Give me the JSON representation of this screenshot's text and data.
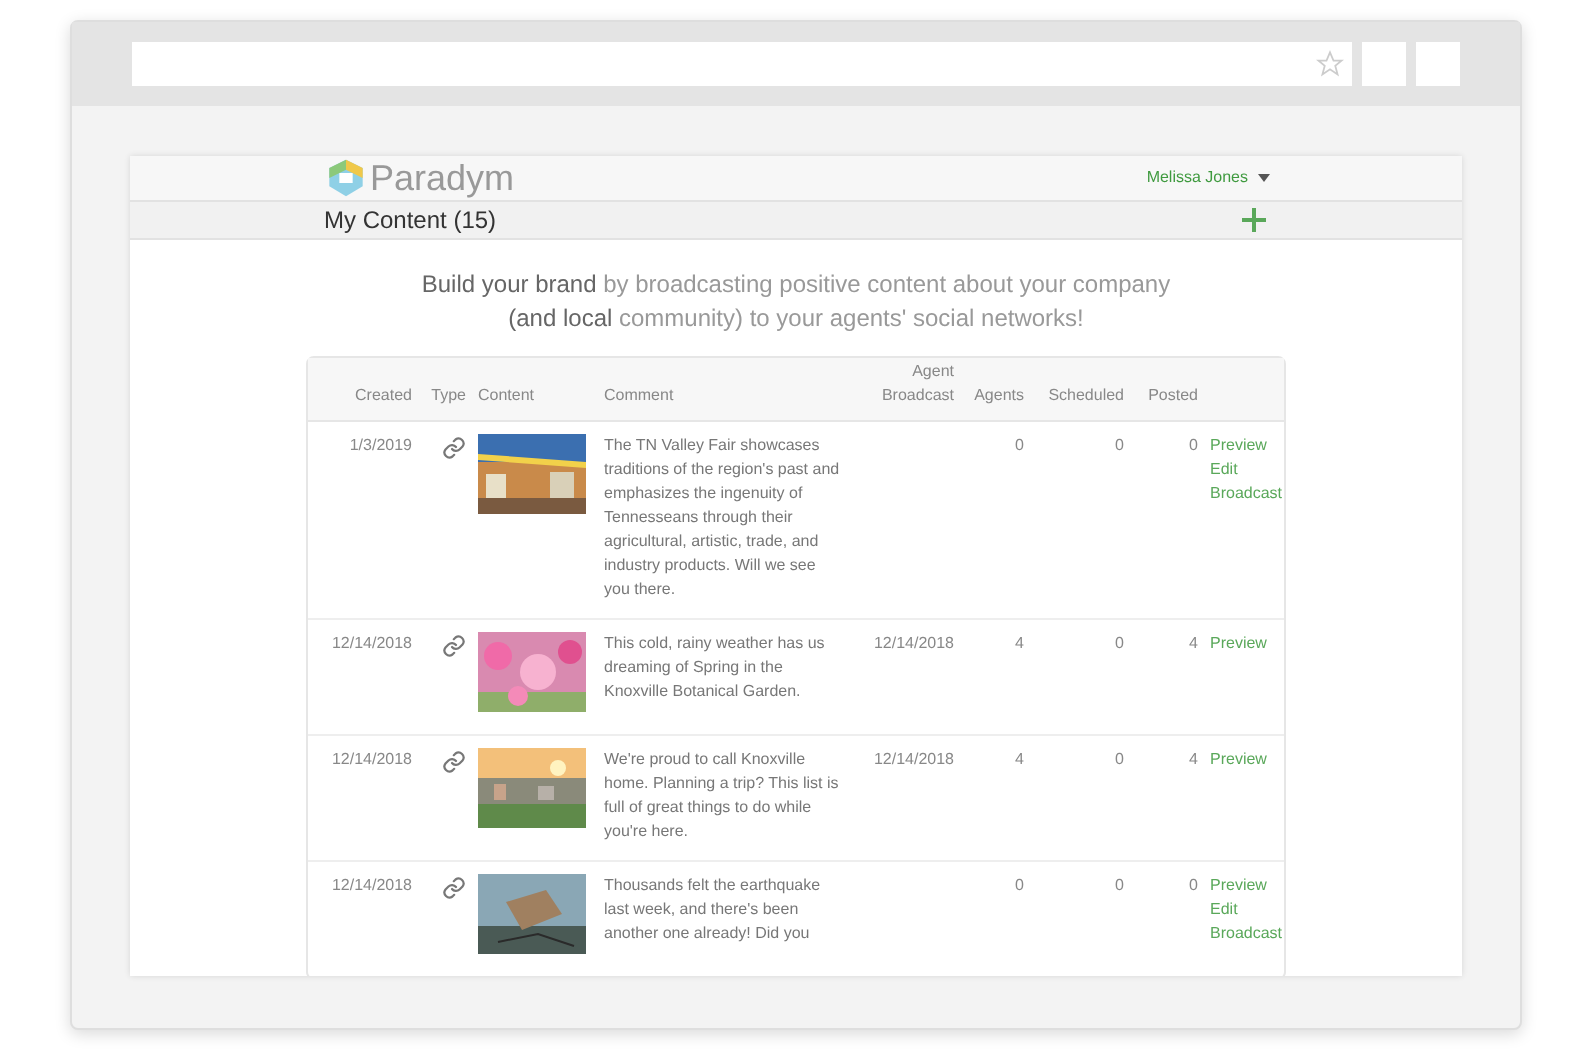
{
  "brand": {
    "name": "Paradym"
  },
  "user_menu": {
    "label": "Melissa Jones"
  },
  "section": {
    "title": "My Content (15)"
  },
  "intro": "**Build your brand** by broadcasting positive content about your company **(and local** community) to your agents' social networks!",
  "table": {
    "columns": [
      "Created",
      "Type",
      "Content",
      "Comment",
      "Agent Broadcast",
      "Agents",
      "Scheduled",
      "Posted"
    ],
    "rows": [
      {
        "created": "1/3/2019",
        "comment": "The TN Valley Fair showcases traditions of the region's past and emphasizes the ingenuity of Tennesseans through their agricultural, artistic, trade, and industry products. Will we see you there.",
        "agent_broadcast": "",
        "agents": "0",
        "scheduled": "0",
        "posted": "0",
        "actions": [
          "Preview",
          "Edit",
          "Broadcast"
        ]
      },
      {
        "created": "12/14/2018",
        "comment": "This cold, rainy weather has us dreaming of Spring in the Knoxville Botanical Garden.",
        "agent_broadcast": "12/14/2018",
        "agents": "4",
        "scheduled": "0",
        "posted": "4",
        "actions": [
          "Preview"
        ]
      },
      {
        "created": "12/14/2018",
        "comment": "We're proud to call Knoxville home. Planning a trip? This list is full of great things to do while you're here.",
        "agent_broadcast": "12/14/2018",
        "agents": "4",
        "scheduled": "0",
        "posted": "4",
        "actions": [
          "Preview"
        ]
      },
      {
        "created": "12/14/2018",
        "comment": "Thousands felt the earthquake last week, and there's been another one already! Did you",
        "agent_broadcast": "",
        "agents": "0",
        "scheduled": "0",
        "posted": "0",
        "actions": [
          "Preview",
          "Edit",
          "Broadcast"
        ]
      }
    ]
  }
}
